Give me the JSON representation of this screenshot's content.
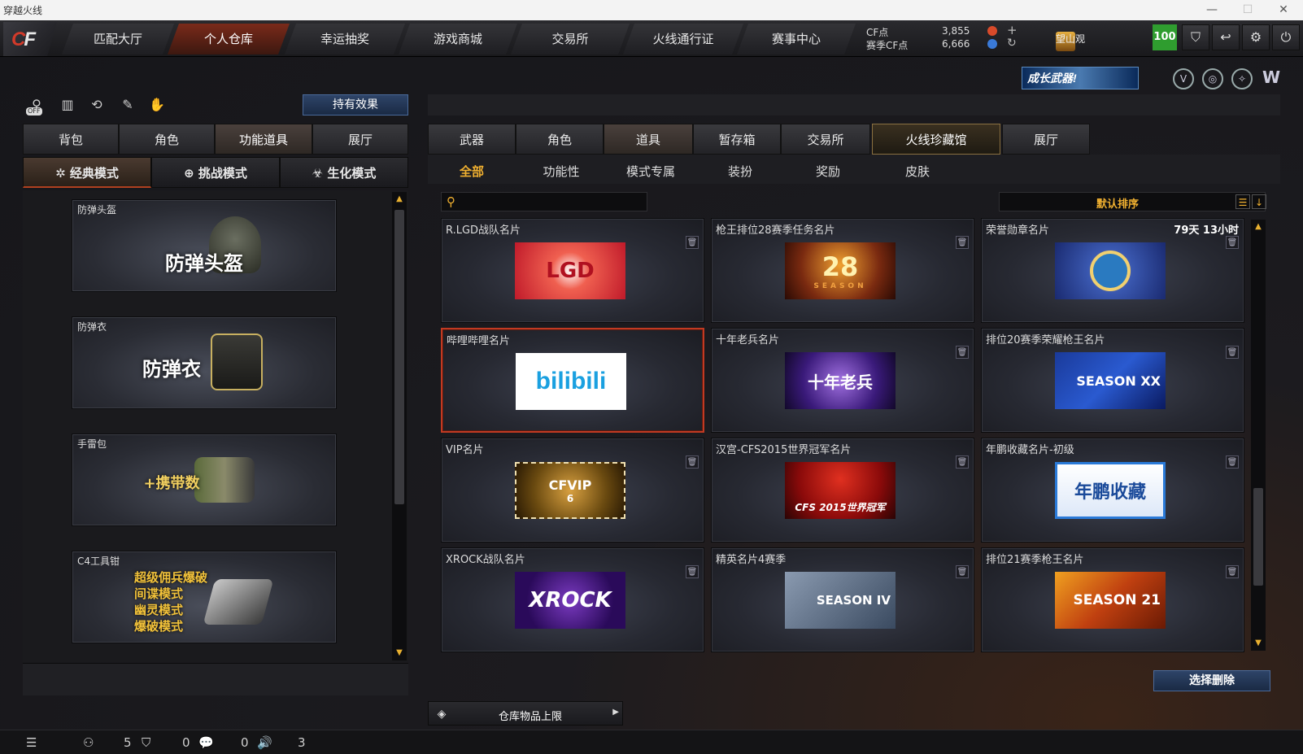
{
  "window": {
    "title": "穿越火线",
    "minimize": "—",
    "maximize": "☐",
    "close": "✕"
  },
  "topnav": {
    "logo": "CF",
    "tabs": [
      "匹配大厅",
      "个人仓库",
      "幸运抽奖",
      "游戏商城",
      "交易所",
      "火线通行证",
      "赛事中心"
    ],
    "active_index": 1
  },
  "currency": {
    "cf_label": "CF点",
    "cf_value": "3,855",
    "season_label": "赛季CF点",
    "season_value": "6,666",
    "plus": "+",
    "refresh": "↻"
  },
  "player": {
    "name": "望山观",
    "level": "100"
  },
  "top_icons": [
    "shield-icon",
    "return-icon",
    "gear-icon",
    "power-icon"
  ],
  "growth_banner": "成长武器!",
  "left_panel": {
    "hold_effect": "持有效果",
    "off_label": "OFF",
    "tabs": [
      "背包",
      "角色",
      "功能道具",
      "展厅"
    ],
    "active_tab": 2,
    "modes": [
      "经典模式",
      "挑战模式",
      "生化模式"
    ],
    "active_mode": 0,
    "items": [
      {
        "name": "防弹头盔",
        "big": "防弹头盔"
      },
      {
        "name": "防弹衣",
        "big": "防弹衣"
      },
      {
        "name": "手雷包",
        "big": "+携带数"
      },
      {
        "name": "C4工具钳",
        "lines": [
          "超级佣兵爆破",
          "间谍模式",
          "幽灵模式",
          "爆破模式"
        ]
      }
    ]
  },
  "right_panel": {
    "tabs": [
      "武器",
      "角色",
      "道具",
      "暂存箱",
      "交易所",
      "火线珍藏馆",
      "展厅"
    ],
    "active_tab": 2,
    "special_tab": 5,
    "sub_tabs": [
      "全部",
      "功能性",
      "模式专属",
      "装扮",
      "奖励",
      "皮肤"
    ],
    "active_sub": 0,
    "search_placeholder": "",
    "sort_label": "默认排序",
    "cards": [
      {
        "name": "R.LGD战队名片",
        "img": "LGD",
        "time": ""
      },
      {
        "name": "枪王排位28赛季任务名片",
        "img": "28",
        "sub": "SEASON",
        "time": ""
      },
      {
        "name": "荣誉勋章名片",
        "img": "",
        "time": "79天 13小时"
      },
      {
        "name": "哔哩哔哩名片",
        "img": "bilibili",
        "time": ""
      },
      {
        "name": "十年老兵名片",
        "img": "十年老兵",
        "time": ""
      },
      {
        "name": "排位20赛季荣耀枪王名片",
        "img": "SEASON XX",
        "time": ""
      },
      {
        "name": "VIP名片",
        "img": "CFVIP",
        "sub": "6",
        "time": ""
      },
      {
        "name": "汉宫-CFS2015世界冠军名片",
        "img": "CFS 2015世界冠军",
        "time": ""
      },
      {
        "name": "年鹏收藏名片-初级",
        "img": "年鹏收藏",
        "time": ""
      },
      {
        "name": "XROCK战队名片",
        "img": "XROCK",
        "time": ""
      },
      {
        "name": "精英名片4赛季",
        "img": "SEASON IV",
        "time": ""
      },
      {
        "name": "排位21赛季枪王名片",
        "img": "SEASON 21",
        "time": ""
      }
    ],
    "selected_card": 3,
    "select_delete": "选择删除",
    "capacity_label": "仓库物品上限"
  },
  "status_bar": {
    "friends": "5",
    "clan": "0",
    "chat": "0",
    "voice": "3"
  },
  "colors": {
    "accent": "#f0b030",
    "active_nav": "#7a2a1a",
    "selected": "#c23a22",
    "level_green": "#2f9d2f"
  }
}
